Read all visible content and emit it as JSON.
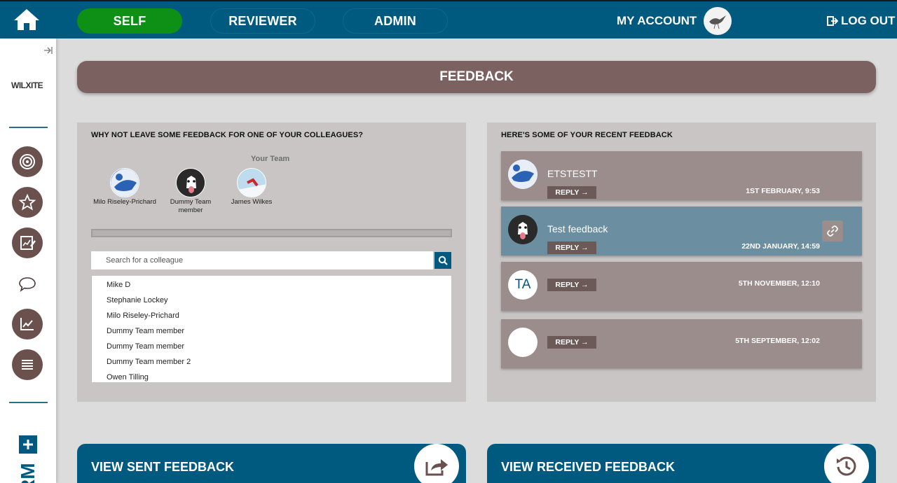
{
  "nav": {
    "tabs": [
      {
        "label": "SELF"
      },
      {
        "label": "REVIEWER"
      },
      {
        "label": "ADMIN"
      }
    ],
    "account_label": "MY ACCOUNT",
    "logout_label": "LOG OUT"
  },
  "sidebar": {
    "logo_text": "WILXITE",
    "items": [
      {
        "icon": "target-icon"
      },
      {
        "icon": "star-icon"
      },
      {
        "icon": "edit-chart-icon"
      },
      {
        "icon": "chat-icon"
      },
      {
        "icon": "trend-icon"
      },
      {
        "icon": "list-icon"
      }
    ],
    "rm_text": "RM"
  },
  "banner": {
    "title": "FEEDBACK"
  },
  "left_panel": {
    "title": "WHY NOT LEAVE SOME FEEDBACK FOR ONE OF YOUR COLLEAGUES?",
    "team_label": "Your Team",
    "team": [
      {
        "name": "Milo Riseley-Prichard"
      },
      {
        "name": "Dummy Team member"
      },
      {
        "name": "James Wilkes"
      }
    ],
    "search_placeholder": "Search for a colleague",
    "colleagues": [
      "Mike D",
      "Stephanie Lockey",
      "Milo Riseley-Prichard",
      "Dummy Team member",
      "Dummy Team member",
      "Dummy Team member 2",
      "Owen Tilling"
    ]
  },
  "right_panel": {
    "title": "HERE'S SOME OF YOUR RECENT FEEDBACK",
    "reply_label": "REPLY →",
    "items": [
      {
        "title": "ETSTESTT",
        "date": "1ST FEBRUARY, 9:53",
        "avatar_text": ""
      },
      {
        "title": "Test feedback",
        "date": "22ND JANUARY, 14:59",
        "avatar_text": ""
      },
      {
        "title": "",
        "date": "5TH NOVEMBER, 12:10",
        "avatar_text": "TA"
      },
      {
        "title": "",
        "date": "5TH SEPTEMBER, 12:02",
        "avatar_text": ""
      }
    ]
  },
  "bottom": {
    "sent_label": "VIEW SENT FEEDBACK",
    "received_label": "VIEW RECEIVED FEEDBACK"
  },
  "colors": {
    "nav_bg": "#005a7f",
    "self_active": "#0e8f16",
    "banner": "#7b6160",
    "card": "#9c8d8d",
    "card_active": "#6b8fa0"
  }
}
